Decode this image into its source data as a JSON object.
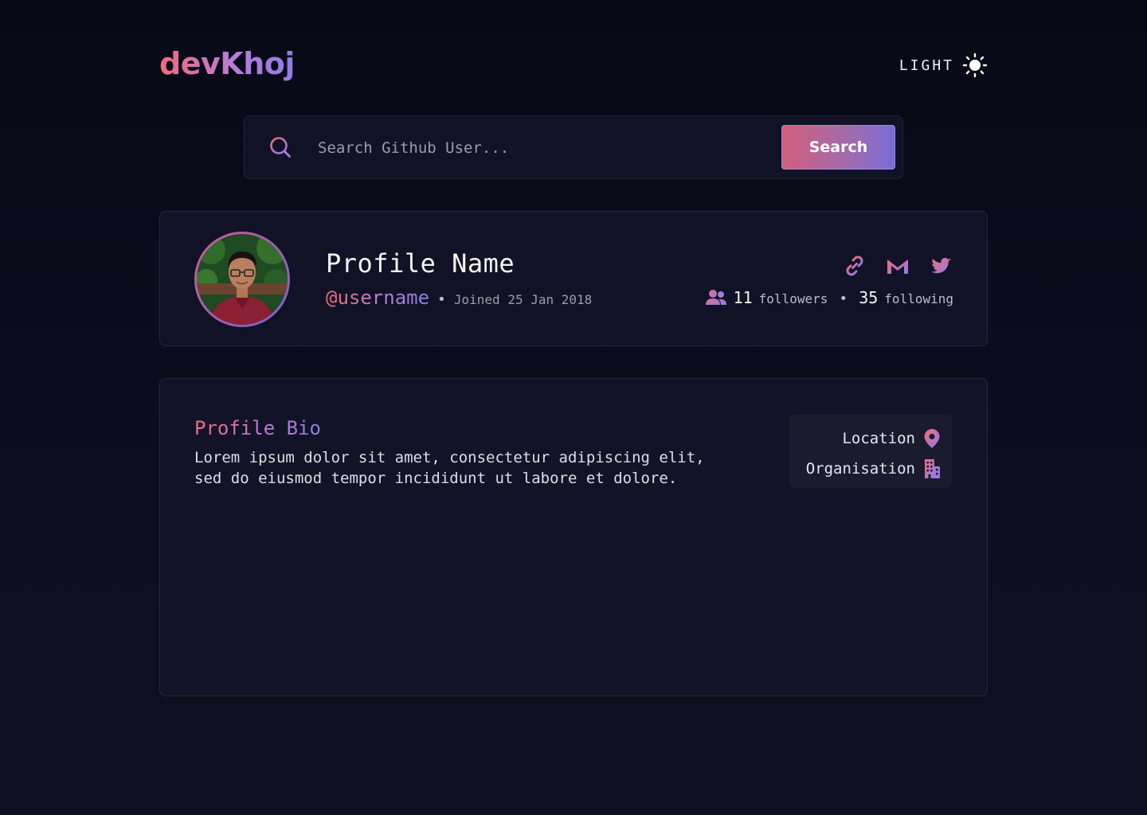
{
  "header": {
    "logo": "devKhoj",
    "theme_label": "LIGHT",
    "theme_icon": "sun-icon"
  },
  "search": {
    "placeholder": "Search Github User...",
    "button_label": "Search",
    "icon": "search-icon"
  },
  "profile": {
    "name": "Profile Name",
    "username": "@username",
    "separator": "•",
    "joined": "Joined 25 Jan 2018",
    "social": [
      "link-icon",
      "gmail-icon",
      "twitter-icon"
    ],
    "followers_count": "11",
    "followers_label": "followers",
    "following_count": "35",
    "following_label": "following"
  },
  "bio": {
    "title": "Profile Bio",
    "text_line1": "Lorem ipsum dolor sit amet, consectetur adipiscing elit,",
    "text_line2": "sed do eiusmod tempor incididunt ut labore et dolore.",
    "location": "Location",
    "organisation": "Organisation"
  },
  "colors": {
    "accent_pink": "#f06b7c",
    "accent_purple": "#8e7ce8",
    "background": "#0a0b18",
    "card": "#111225"
  }
}
